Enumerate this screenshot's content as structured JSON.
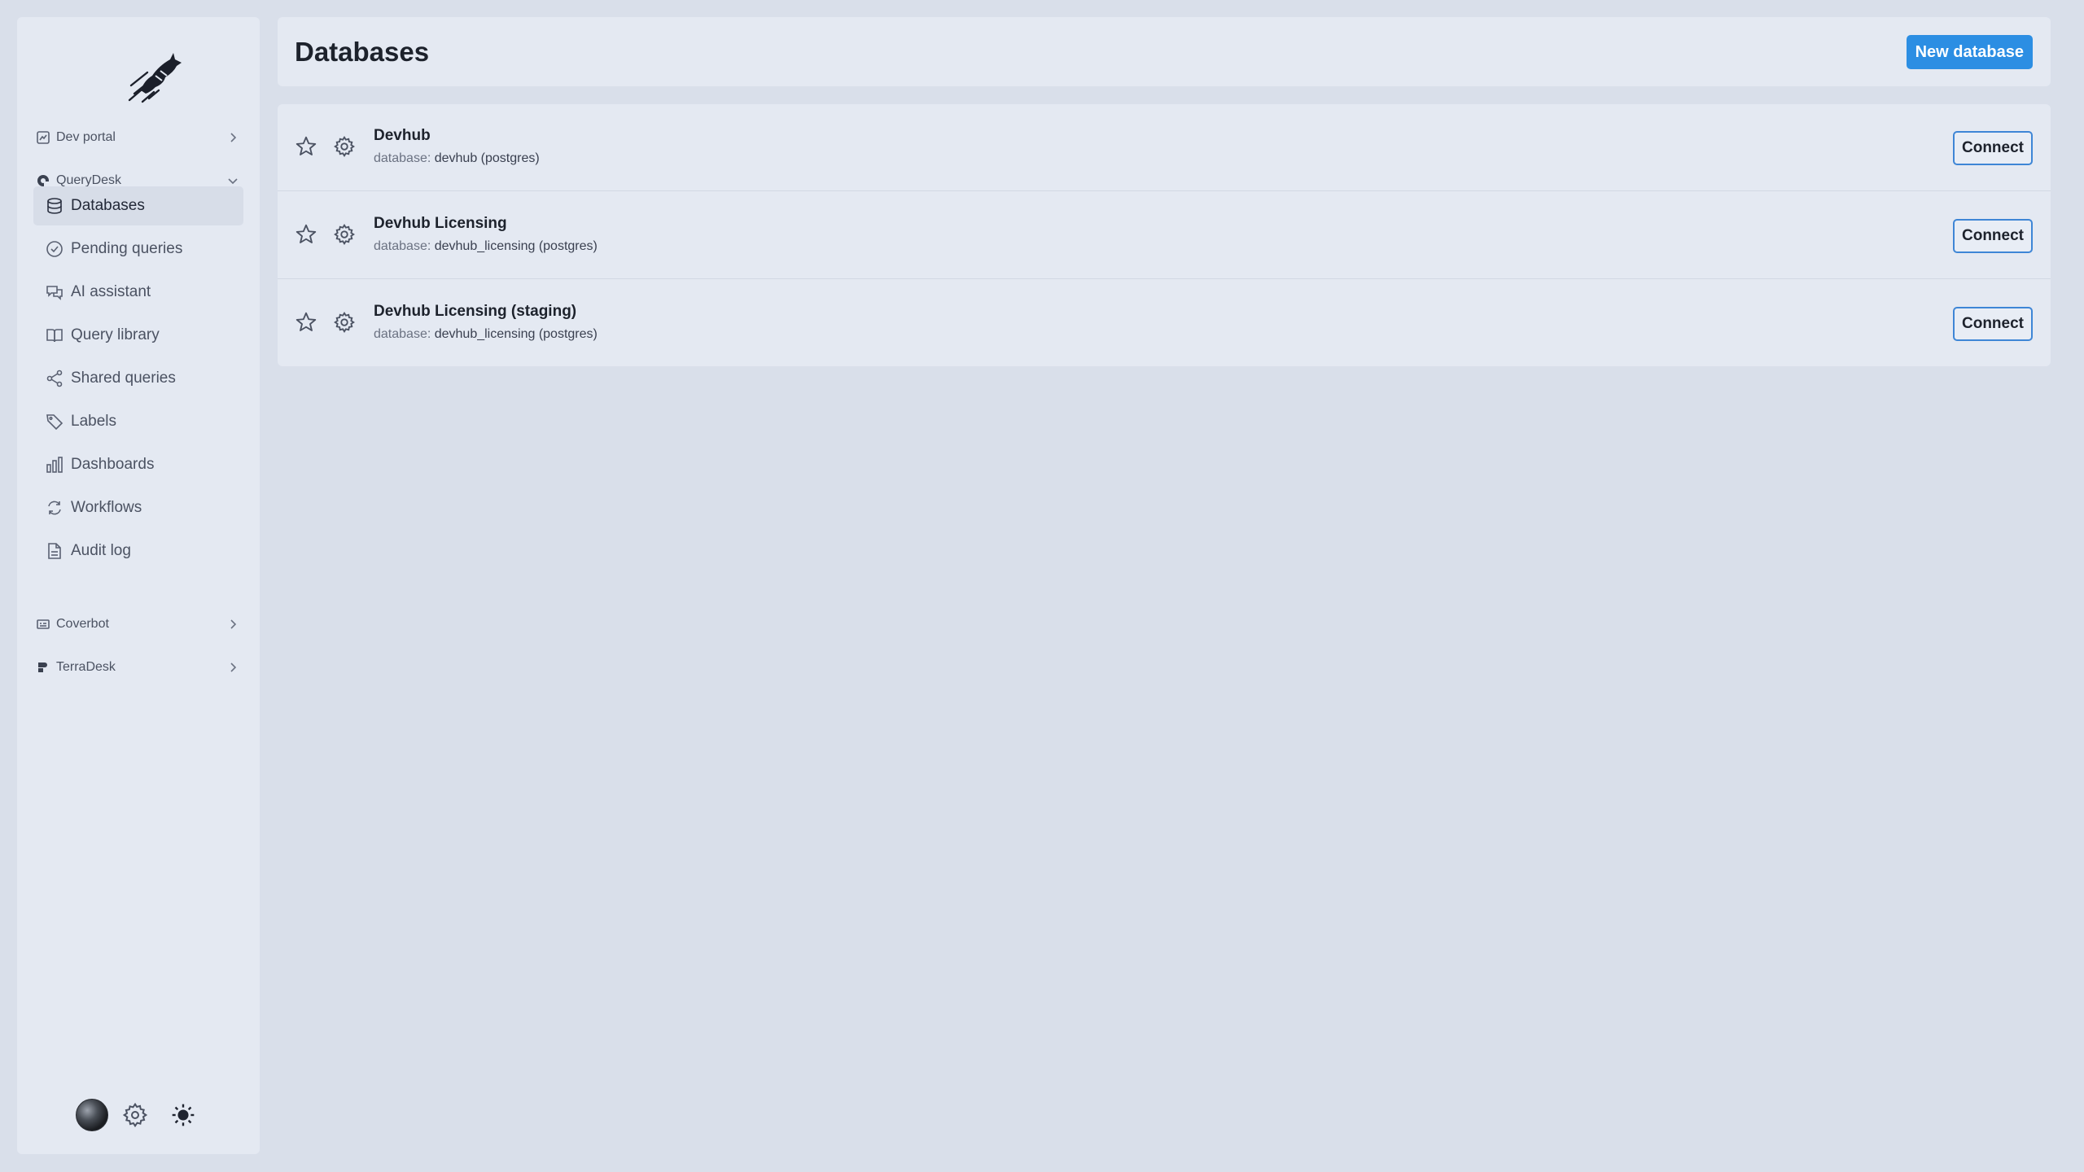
{
  "sidebar": {
    "sections": {
      "dev_portal": "Dev portal",
      "querydesk": "QueryDesk",
      "coverbot": "Coverbot",
      "terradesk": "TerraDesk"
    },
    "items": [
      {
        "label": "Databases",
        "icon": "database-icon",
        "active": true
      },
      {
        "label": "Pending queries",
        "icon": "check-circle-icon"
      },
      {
        "label": "AI assistant",
        "icon": "chat-icon"
      },
      {
        "label": "Query library",
        "icon": "book-icon"
      },
      {
        "label": "Shared queries",
        "icon": "share-icon"
      },
      {
        "label": "Labels",
        "icon": "tag-icon"
      },
      {
        "label": "Dashboards",
        "icon": "bar-chart-icon"
      },
      {
        "label": "Workflows",
        "icon": "refresh-icon"
      },
      {
        "label": "Audit log",
        "icon": "document-icon"
      }
    ]
  },
  "header": {
    "title": "Databases",
    "new_button": "New database"
  },
  "databases": [
    {
      "name": "Devhub",
      "prefix": "database:",
      "detail": "devhub (postgres)",
      "connect": "Connect"
    },
    {
      "name": "Devhub Licensing",
      "prefix": "database:",
      "detail": "devhub_licensing (postgres)",
      "connect": "Connect"
    },
    {
      "name": "Devhub Licensing (staging)",
      "prefix": "database:",
      "detail": "devhub_licensing (postgres)",
      "connect": "Connect"
    }
  ],
  "colors": {
    "accent": "#2c8ee3",
    "background": "#d9dfea",
    "panel": "#e4e9f2"
  }
}
